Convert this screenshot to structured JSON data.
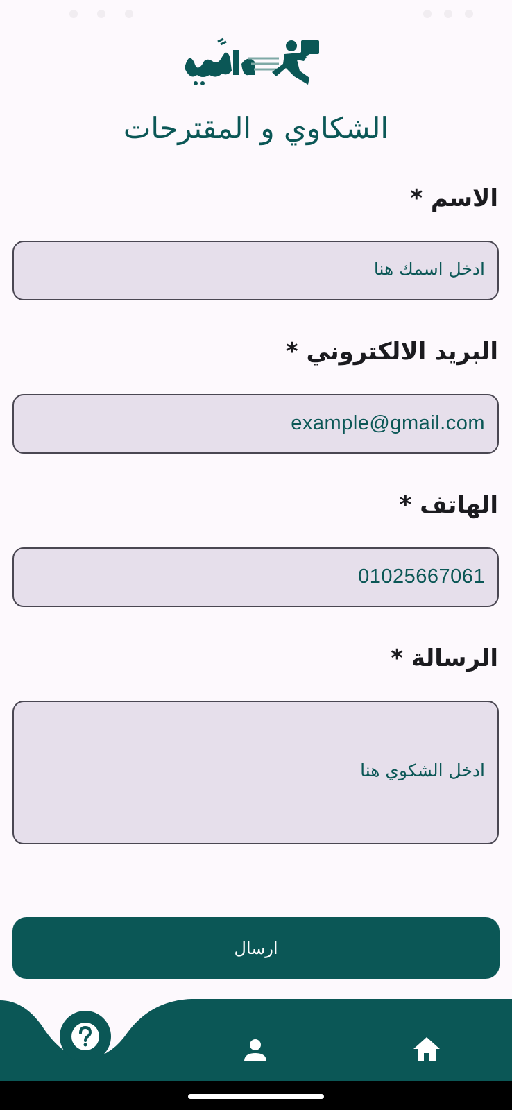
{
  "app": {
    "logo_alt": "logo",
    "brand_color": "#0b5756",
    "field_background": "#e6dfeb"
  },
  "page": {
    "title": "الشكاوي و المقترحات"
  },
  "form": {
    "name": {
      "label": "الاسم *",
      "placeholder": "ادخل اسمك هنا"
    },
    "email": {
      "label": "البريد الالكتروني *",
      "value": "example@gmail.com"
    },
    "phone": {
      "label": "الهاتف *",
      "value": "01025667061"
    },
    "message": {
      "label": "الرسالة *",
      "placeholder": "ادخل الشكوي هنا"
    },
    "submit_label": "ارسال"
  },
  "bottom_nav": {
    "items": [
      {
        "icon": "help-icon",
        "active": true
      },
      {
        "icon": "person-icon",
        "active": false
      },
      {
        "icon": "home-icon",
        "active": false
      }
    ]
  }
}
